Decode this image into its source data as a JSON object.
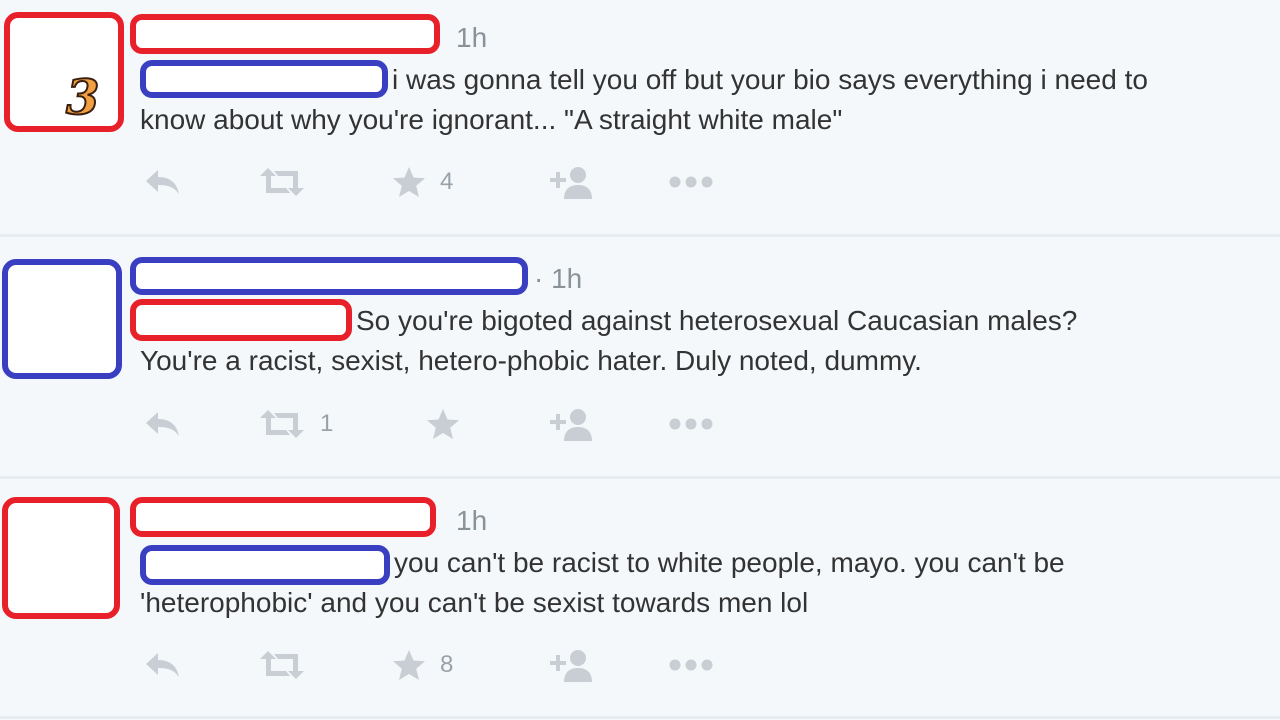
{
  "tweets": [
    {
      "time": "1h",
      "text_line1": "i was gonna tell you off but your bio says everything i need to",
      "text_line2": "know about why you're ignorant... \"A straight white male\"",
      "badge": "3",
      "retweets": "",
      "favorites": "4"
    },
    {
      "time": "· 1h",
      "text_line1": "So you're bigoted against heterosexual Caucasian males?",
      "text_line2": "You're a racist, sexist, hetero-phobic hater.  Duly noted, dummy.",
      "retweets": "1",
      "favorites": ""
    },
    {
      "time": "1h",
      "text_line1": "you can't be racist to white people, mayo. you can't be",
      "text_line2": "'heterophobic' and you can't be sexist towards men lol",
      "retweets": "",
      "favorites": "8"
    }
  ],
  "icons": [
    "reply-icon",
    "retweet-icon",
    "favorite-icon",
    "follow-icon",
    "more-icon"
  ],
  "colors": {
    "red_highlight": "#e8202a",
    "blue_highlight": "#3a3fc2",
    "background": "#f5f8fa",
    "icon": "#c8ced4"
  }
}
